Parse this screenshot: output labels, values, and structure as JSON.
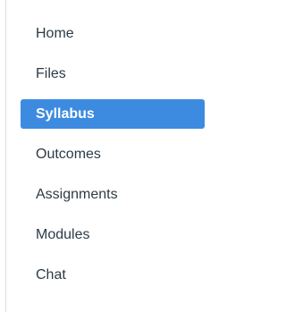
{
  "nav": {
    "items": [
      {
        "label": "Home"
      },
      {
        "label": "Files"
      },
      {
        "label": "Syllabus",
        "active": true
      },
      {
        "label": "Outcomes"
      },
      {
        "label": "Assignments"
      },
      {
        "label": "Modules"
      },
      {
        "label": "Chat"
      }
    ],
    "active_color": "#3d8be0",
    "text_color": "#2d3b45"
  }
}
